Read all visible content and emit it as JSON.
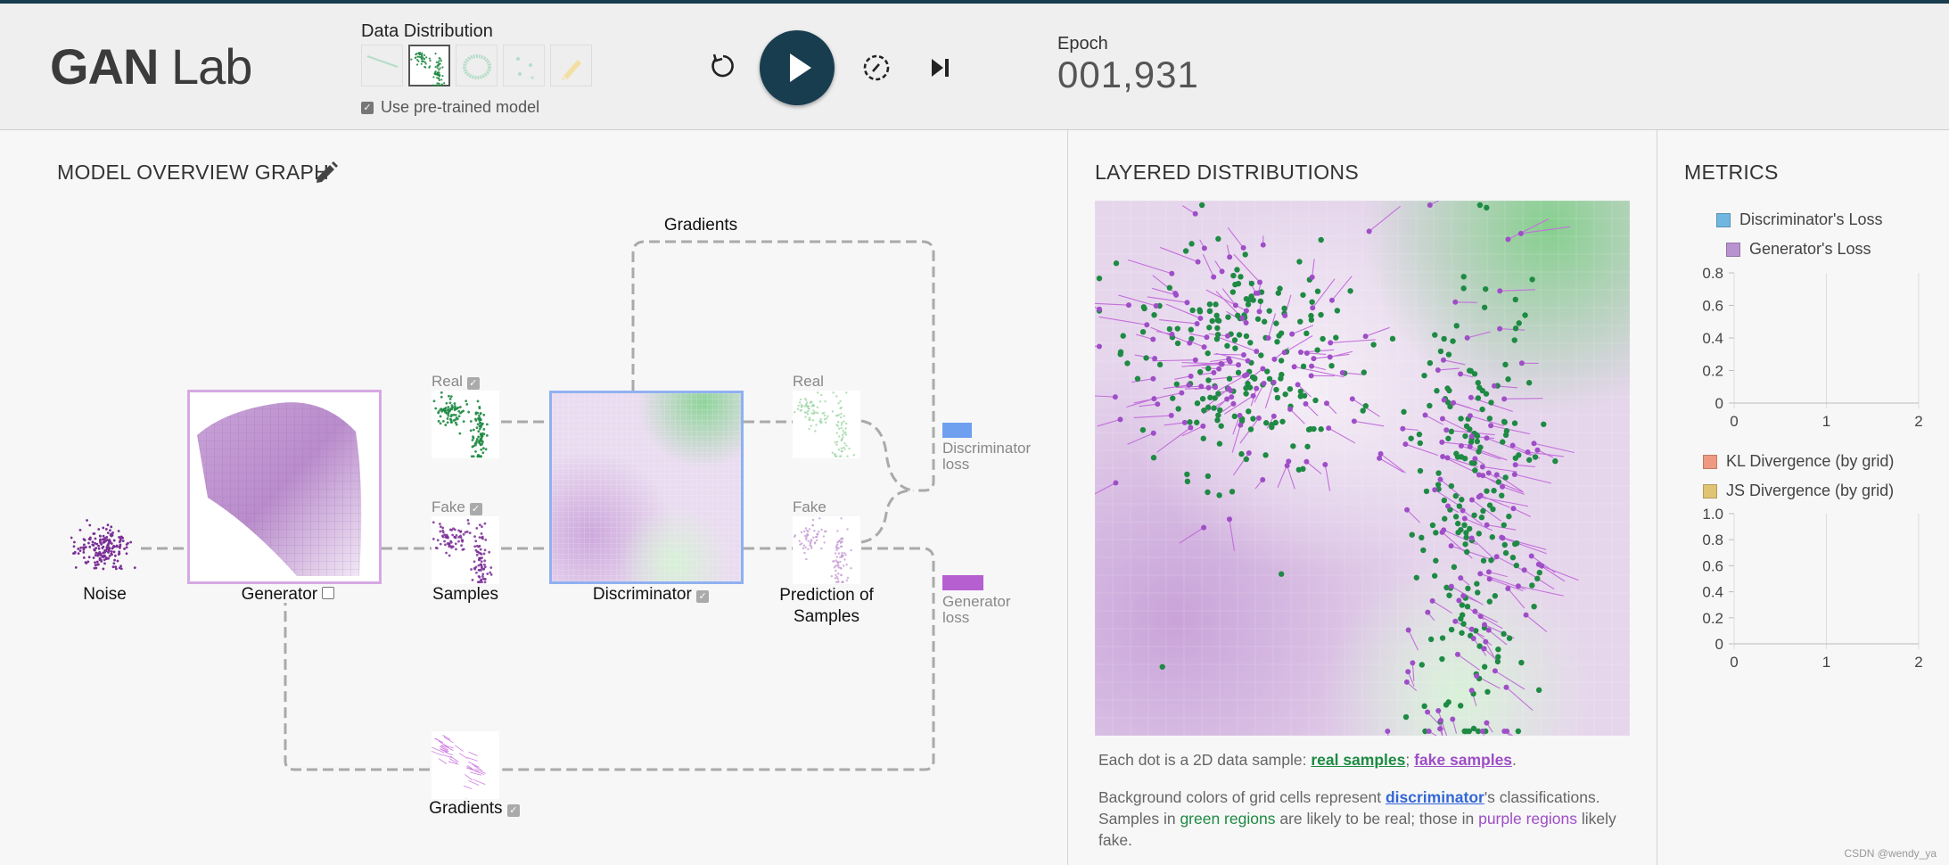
{
  "app": {
    "title_bold": "GAN",
    "title_rest": " Lab"
  },
  "header": {
    "data_distribution_label": "Data Distribution",
    "distributions": [
      "line",
      "two-clusters",
      "ring",
      "gaussian-dots",
      "drawing"
    ],
    "selected_distribution": "two-clusters",
    "pretrained_label": "Use pre-trained model",
    "pretrained_checked": true,
    "epoch_label": "Epoch",
    "epoch_value": "001,931"
  },
  "controls": [
    "reset-icon",
    "play-icon",
    "slow-motion-icon",
    "step-icon"
  ],
  "overview": {
    "title": "MODEL OVERVIEW GRAPH",
    "gradients_top": "Gradients",
    "real_label_1": "Real",
    "fake_label_1": "Fake",
    "real_label_2": "Real",
    "fake_label_2": "Fake",
    "noise": "Noise",
    "generator": "Generator",
    "samples": "Samples",
    "discriminator": "Discriminator",
    "prediction_line1": "Prediction of",
    "prediction_line2": "Samples",
    "disc_loss_line1": "Discriminator",
    "disc_loss_line2": "loss",
    "gen_loss_line1": "Generator",
    "gen_loss_line2": "loss",
    "gradients_bottom": "Gradients"
  },
  "layered": {
    "title": "LAYERED DISTRIBUTIONS",
    "desc1_prefix": "Each dot is a 2D data sample: ",
    "real_link": "real samples",
    "sep": "; ",
    "fake_link": "fake samples",
    "desc1_suffix": ".",
    "desc2_prefix": "Background colors of grid cells represent ",
    "disc_link": "discriminator",
    "desc2_mid": "'s classifications.",
    "desc3_a": "Samples in ",
    "green_regions": "green regions",
    "desc3_b": " are likely to be real; those in ",
    "purple_regions": "purple regions",
    "desc3_c": " likely",
    "desc4": "fake."
  },
  "metrics": {
    "title": "METRICS",
    "legend1": [
      "Discriminator's Loss",
      "Generator's Loss"
    ],
    "legend2": [
      "KL Divergence (by grid)",
      "JS Divergence (by grid)"
    ],
    "chart1_yticks": [
      "0.8",
      "0.6",
      "0.4",
      "0.2",
      "0"
    ],
    "chart1_xticks": [
      "0",
      "1",
      "2"
    ],
    "chart2_yticks": [
      "1.0",
      "0.8",
      "0.6",
      "0.4",
      "0.2",
      "0"
    ],
    "chart2_xticks": [
      "0",
      "1",
      "2"
    ]
  },
  "colors": {
    "real": "#1e8a43",
    "fake": "#9e4ec6",
    "discriminator_link": "#3367d6",
    "disc_loss": "#6fa0ef",
    "gen_loss": "#b55fd1",
    "kl": "#ef9a80",
    "js": "#e0c373",
    "dark": "#183d4e"
  },
  "watermark": "CSDN @wendy_ya"
}
